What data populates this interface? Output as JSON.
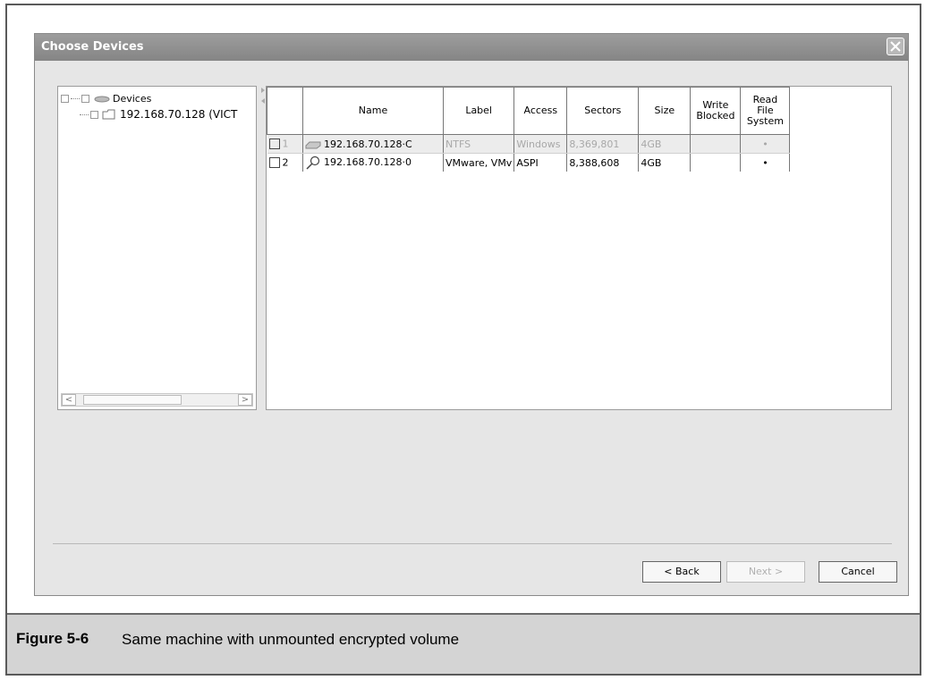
{
  "window": {
    "title": "Choose Devices"
  },
  "tree": {
    "root_label": "Devices",
    "child_label": "192.168.70.128 (VICT"
  },
  "table": {
    "headers": {
      "name": "Name",
      "label": "Label",
      "access": "Access",
      "sectors": "Sectors",
      "size": "Size",
      "write_blocked": "Write Blocked",
      "read_file_system": "Read File System"
    },
    "rows": [
      {
        "num": "1",
        "name": "192.168.70.128·C",
        "label": "NTFS",
        "access": "Windows",
        "sectors": "8,369,801",
        "size": "4GB",
        "write_blocked": "",
        "read_file_system": "•",
        "icon": "hard-drive-icon"
      },
      {
        "num": "2",
        "name": "192.168.70.128·0",
        "label": "VMware, VMv",
        "access": "ASPI",
        "sectors": "8,388,608",
        "size": "4GB",
        "write_blocked": "",
        "read_file_system": "•",
        "icon": "magnifier-disk-icon"
      }
    ]
  },
  "buttons": {
    "back": "< Back",
    "next": "Next >",
    "cancel": "Cancel"
  },
  "caption": {
    "label": "Figure 5-6",
    "text": "Same machine with unmounted encrypted volume"
  }
}
